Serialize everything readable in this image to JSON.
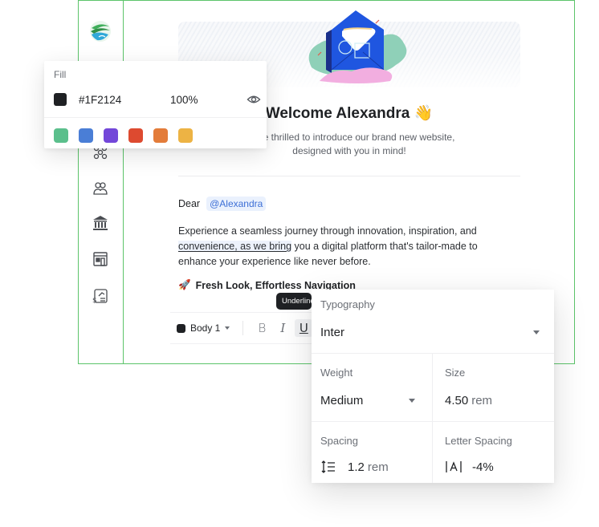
{
  "sidebar": {
    "logo": "globe-leaf-logo",
    "items": [
      {
        "icon": "network-icon"
      },
      {
        "icon": "users-icon"
      },
      {
        "icon": "bank-icon"
      },
      {
        "icon": "storefront-icon"
      },
      {
        "icon": "finance-chart-icon"
      }
    ]
  },
  "email": {
    "title": "Welcome Alexandra 👋",
    "subtitle_line1": "We're thrilled to introduce our brand new website,",
    "subtitle_line2": "designed with you in mind!",
    "greeting": "Dear",
    "mention": "@Alexandra",
    "body_pre": "Experience a seamless journey through innovation, inspiration, and ",
    "body_highlight": "convenience, as we bring",
    "body_post": " you a digital platform that's tailor-made to enhance your experience like never before.",
    "heading_emoji": "🚀",
    "heading": "Fresh Look, Effortless Navigation"
  },
  "toolbar": {
    "text_color": "#1F2124",
    "style": "Body 1",
    "bold": "B",
    "italic": "I",
    "underline": "U",
    "tooltip": "Underline"
  },
  "fill": {
    "title": "Fill",
    "hex": "#1F2124",
    "opacity": "100%",
    "presets": [
      "#5bbf8c",
      "#4a7ed6",
      "#7347d9",
      "#dd4a30",
      "#e37c3a",
      "#edb344"
    ]
  },
  "typography": {
    "title": "Typography",
    "font": "Inter",
    "weight_label": "Weight",
    "weight": "Medium",
    "size_label": "Size",
    "size_value": "4.50",
    "size_unit": "rem",
    "spacing_label": "Spacing",
    "spacing_value": "1.2",
    "spacing_unit": "rem",
    "letter_spacing_label": "Letter Spacing",
    "letter_spacing_value": "-4%"
  },
  "colors": {
    "frame_border": "#5cc46a",
    "accent": "#3c6fd6"
  }
}
